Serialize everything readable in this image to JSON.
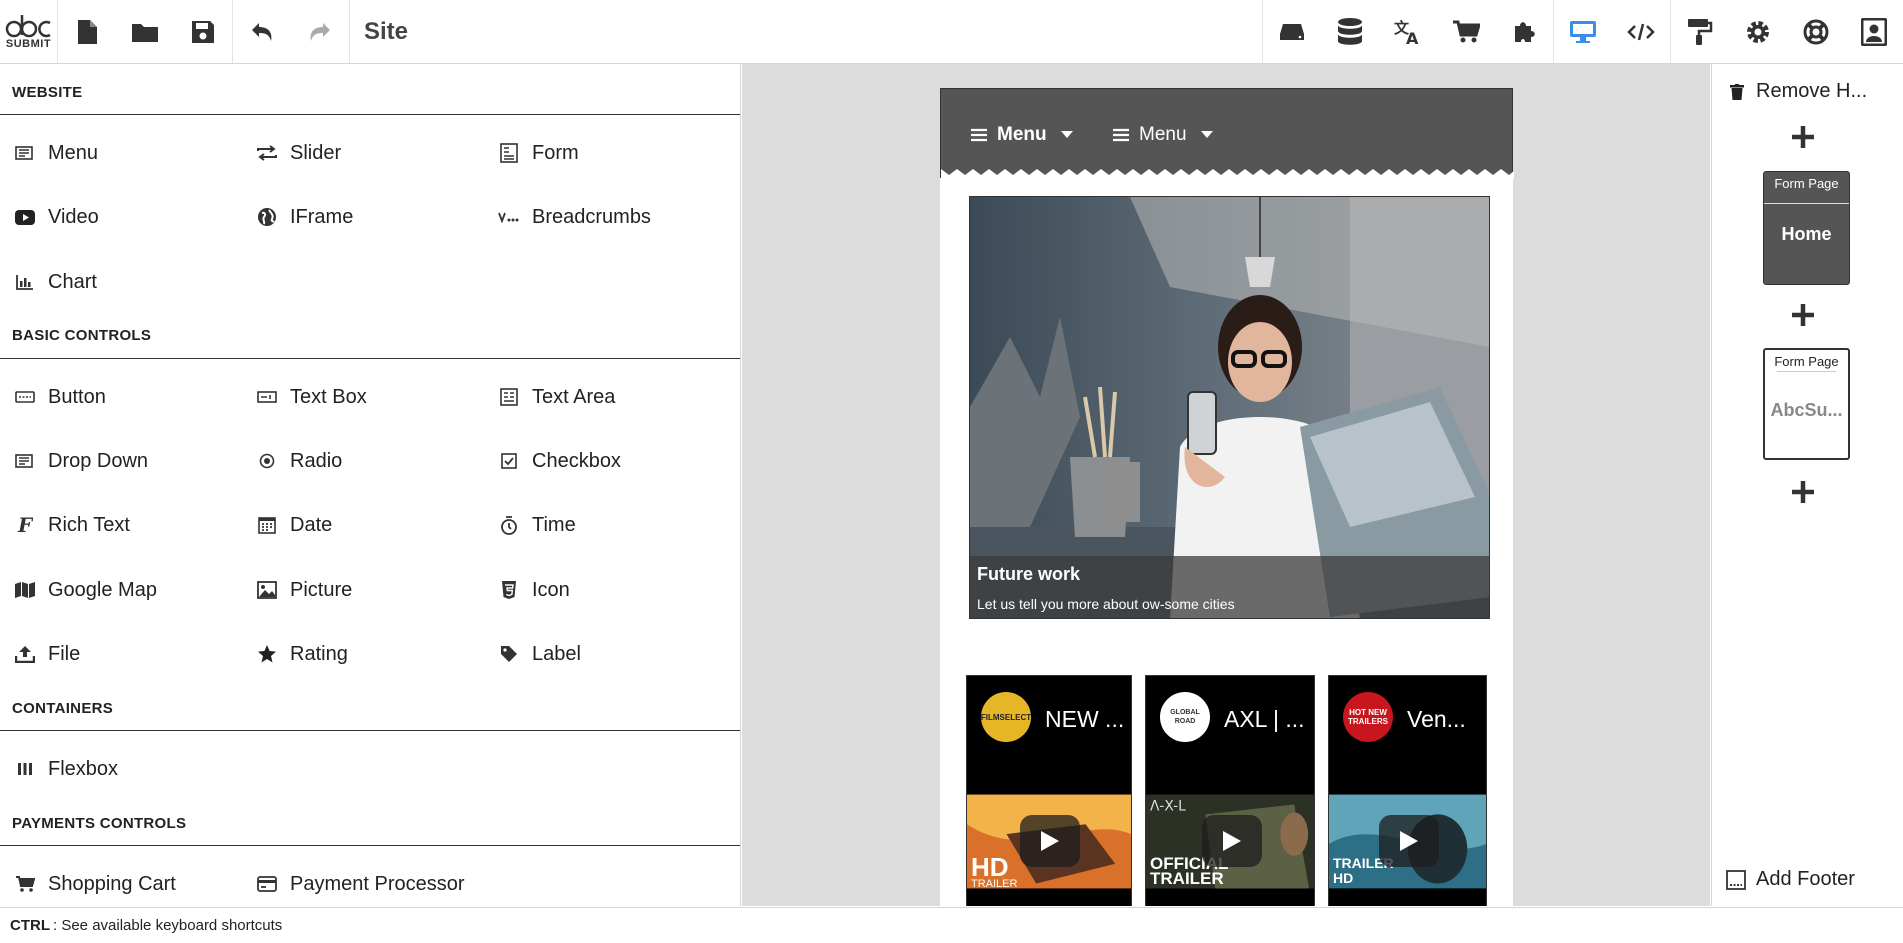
{
  "app": {
    "logo_text": "SUBMIT",
    "site_title": "Site"
  },
  "toolbar_left": [
    {
      "name": "new-page-icon"
    },
    {
      "name": "open-folder-icon"
    },
    {
      "name": "save-icon"
    },
    {
      "name": "undo-icon"
    },
    {
      "name": "redo-icon"
    }
  ],
  "toolbar_right": [
    {
      "name": "storage-icon"
    },
    {
      "name": "database-icon"
    },
    {
      "name": "translate-icon"
    },
    {
      "name": "shopping-cart-icon"
    },
    {
      "name": "plugin-icon"
    },
    {
      "name": "desktop-view-icon",
      "active": true
    },
    {
      "name": "code-icon"
    },
    {
      "name": "paint-roller-icon"
    },
    {
      "name": "settings-gear-icon"
    },
    {
      "name": "help-lifebuoy-icon"
    },
    {
      "name": "account-icon"
    }
  ],
  "sections": {
    "website": {
      "title": "WEBSITE",
      "items": [
        {
          "label": "Menu",
          "icon": "menu-control-icon"
        },
        {
          "label": "Slider",
          "icon": "slider-icon"
        },
        {
          "label": "Form",
          "icon": "form-icon"
        },
        {
          "label": "Video",
          "icon": "video-icon"
        },
        {
          "label": "IFrame",
          "icon": "globe-icon"
        },
        {
          "label": "Breadcrumbs",
          "icon": "breadcrumbs-icon"
        },
        {
          "label": "Chart",
          "icon": "chart-icon"
        }
      ]
    },
    "basic": {
      "title": "BASIC CONTROLS",
      "items": [
        {
          "label": "Button",
          "icon": "button-icon"
        },
        {
          "label": "Text Box",
          "icon": "textbox-icon"
        },
        {
          "label": "Text Area",
          "icon": "textarea-icon"
        },
        {
          "label": "Drop Down",
          "icon": "dropdown-icon"
        },
        {
          "label": "Radio",
          "icon": "radio-icon"
        },
        {
          "label": "Checkbox",
          "icon": "checkbox-icon"
        },
        {
          "label": "Rich Text",
          "icon": "rich-text-icon"
        },
        {
          "label": "Date",
          "icon": "calendar-icon"
        },
        {
          "label": "Time",
          "icon": "stopwatch-icon"
        },
        {
          "label": "Google Map",
          "icon": "map-icon"
        },
        {
          "label": "Picture",
          "icon": "picture-icon"
        },
        {
          "label": "Icon",
          "icon": "html5-icon"
        },
        {
          "label": "File",
          "icon": "upload-icon"
        },
        {
          "label": "Rating",
          "icon": "star-icon"
        },
        {
          "label": "Label",
          "icon": "tag-icon"
        }
      ]
    },
    "containers": {
      "title": "CONTAINERS",
      "items": [
        {
          "label": "Flexbox",
          "icon": "flexbox-icon"
        }
      ]
    },
    "payments": {
      "title": "PAYMENTS CONTROLS",
      "items": [
        {
          "label": "Shopping Cart",
          "icon": "shopping-cart-icon"
        },
        {
          "label": "Payment Processor",
          "icon": "credit-card-icon"
        }
      ]
    }
  },
  "preview": {
    "menu_items": [
      "Menu",
      "Menu"
    ],
    "slide": {
      "title": "Future work",
      "subtitle": "Let us tell you more about ow-some cities"
    },
    "videos": [
      {
        "title": "NEW ...",
        "logo": "FILMSELECT",
        "badge": "HD",
        "badge_sub": "TRAILER"
      },
      {
        "title": "AXL | ...",
        "logo": "GLOBAL ROAD",
        "badge": "OFFICIAL",
        "badge_sub": "TRAILER"
      },
      {
        "title": "Ven...",
        "logo": "HOT NEW TRAILERS",
        "badge": "TRAILER",
        "badge_sub": "HD"
      }
    ]
  },
  "right_panel": {
    "remove_label": "Remove H...",
    "pages": [
      {
        "type_label": "Form Page",
        "name": "Home",
        "selected": true
      },
      {
        "type_label": "Form Page",
        "name": "AbcSu...",
        "selected": false
      }
    ],
    "footer_label": "Add Footer"
  },
  "status": {
    "key": "CTRL",
    "text": ": See available keyboard shortcuts"
  }
}
